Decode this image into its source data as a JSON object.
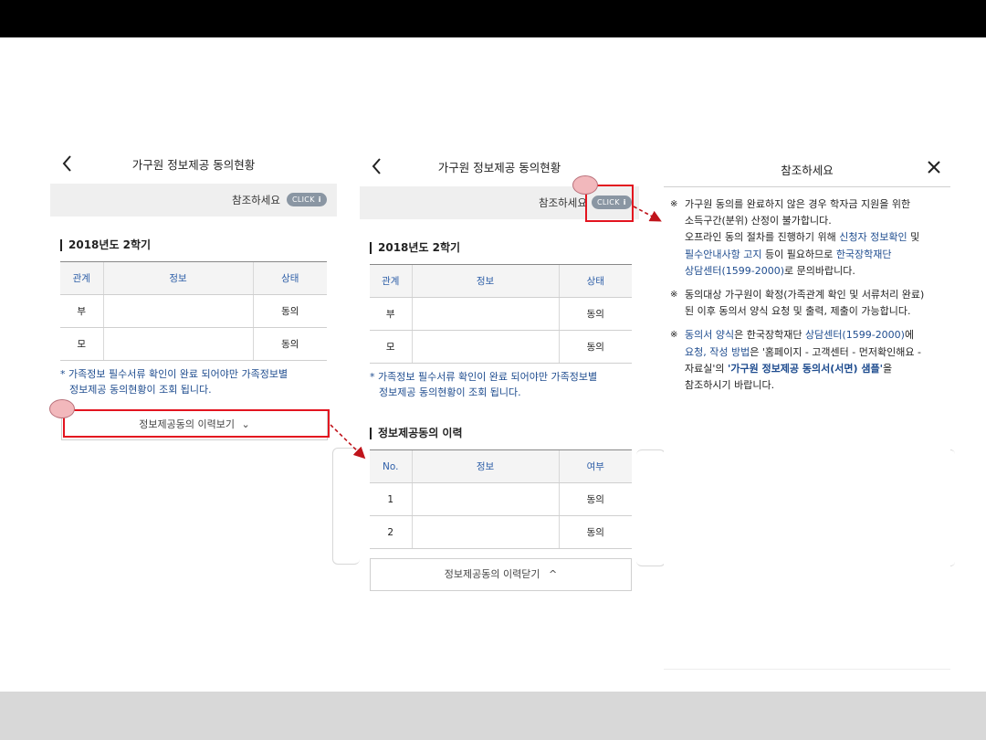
{
  "screen1": {
    "title": "가구원 정보제공 동의현황",
    "notice_text": "참조하세요",
    "click_label": "CLICK",
    "click_icon": "i",
    "semester": "2018년도 2학기",
    "table": {
      "headers": [
        "관계",
        "정보",
        "상태"
      ],
      "rows": [
        [
          "부",
          "",
          "동의"
        ],
        [
          "모",
          "",
          "동의"
        ]
      ]
    },
    "note_line1": "* 가족정보 필수서류 확인이 완료 되어야만 가족정보별",
    "note_line2": "정보제공 동의현황이 조회 됩니다.",
    "history_button": "정보제공동의 이력보기",
    "history_chevron": "⌄"
  },
  "screen2": {
    "title": "가구원 정보제공 동의현황",
    "notice_text": "참조하세요",
    "click_label": "CLICK",
    "click_icon": "i",
    "semester": "2018년도 2학기",
    "table": {
      "headers": [
        "관계",
        "정보",
        "상태"
      ],
      "rows": [
        [
          "부",
          "",
          "동의"
        ],
        [
          "모",
          "",
          "동의"
        ]
      ]
    },
    "note_line1": "* 가족정보 필수서류 확인이 완료 되어야만 가족정보별",
    "note_line2": "정보제공 동의현황이 조회 됩니다.",
    "history_title": "정보제공동의 이력",
    "history_table": {
      "headers": [
        "No.",
        "정보",
        "여부"
      ],
      "rows": [
        [
          "1",
          "",
          "동의"
        ],
        [
          "2",
          "",
          "동의"
        ]
      ]
    },
    "close_history_button": "정보제공동의 이력닫기",
    "close_chevron": "^"
  },
  "screen3": {
    "title": "참조하세요",
    "close_icon": "close-icon",
    "mark": "※",
    "item1": {
      "l1": "가구원 동의를 완료하지 않은 경우 학자금 지원을 위한",
      "l2": "소득구간(분위) 산정이 불가합니다.",
      "l3a": "오프라인 동의 절차를 진행하기 위해 ",
      "l3b": "신청자 정보확인",
      "l3c": " 및",
      "l4a": "필수안내사항 고지",
      "l4b": " 등이 필요하므로 ",
      "l4c": "한국장학재단",
      "l5a": "상담센터(1599-2000)",
      "l5b": "로 문의바랍니다."
    },
    "item2": {
      "l1": "동의대상 가구원이 확정(가족관계 확인 및 서류처리 완료)",
      "l2": "된 이후 동의서 양식 요청 및 출력, 제출이 가능합니다."
    },
    "item3": {
      "l1a": "동의서 양식",
      "l1b": "은 한국장학재단 ",
      "l1c": "상담센터(1599-2000)",
      "l1d": "에",
      "l2a": "요청, 작성 방법",
      "l2b": "은 '홈페이지 - 고객센터 - 먼저확인해요 -",
      "l3a": "자료실'의 ",
      "l3b": "'가구원 정보제공 동의서(서면) 샘플'",
      "l3c": "을",
      "l4": "참조하시기 바랍니다."
    }
  },
  "colors": {
    "highlight": "#e3141f",
    "accent_blue": "#1e4c8f",
    "badge": "#8a96a3"
  }
}
